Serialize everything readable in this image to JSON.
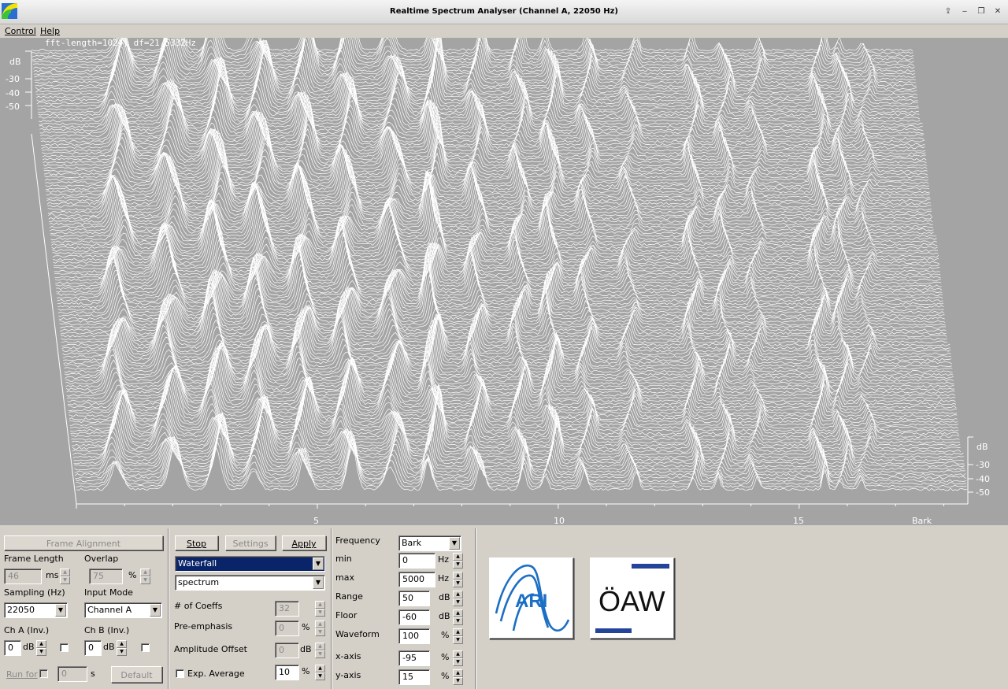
{
  "window": {
    "title": "Realtime Spectrum Analyser (Channel A, 22050 Hz)",
    "controls": {
      "pin": "⇪",
      "minimize": "‒",
      "restore": "❐",
      "close": "✕"
    }
  },
  "menu": [
    {
      "label": "Control"
    },
    {
      "label": "Help"
    }
  ],
  "plot": {
    "fft_info": "fft-length=1024, df=21.5332Hz",
    "left_axis": {
      "unit": "dB",
      "ticks": [
        "-30",
        "-40",
        "-50"
      ]
    },
    "right_axis": {
      "unit": "dB",
      "ticks": [
        "-30",
        "-40",
        "-50"
      ]
    },
    "x_axis": {
      "ticks": [
        "5",
        "10",
        "15"
      ],
      "unit": "Bark"
    }
  },
  "panel": {
    "frame_alignment": "Frame Alignment",
    "frame_length": {
      "label": "Frame Length",
      "value": "46",
      "unit": "ms"
    },
    "overlap": {
      "label": "Overlap",
      "value": "75",
      "unit": "%"
    },
    "sampling": {
      "label": "Sampling (Hz)",
      "value": "22050"
    },
    "input_mode": {
      "label": "Input Mode",
      "value": "Channel A"
    },
    "ch_a": {
      "label": "Ch A (Inv.)",
      "value": "0",
      "unit": "dB"
    },
    "ch_b": {
      "label": "Ch B (Inv.)",
      "value": "0",
      "unit": "dB"
    },
    "run_for": {
      "label": "Run for",
      "value": "0",
      "unit": "s"
    },
    "default_button": "Default",
    "stop_button": "Stop",
    "settings_button": "Settings",
    "apply_button": "Apply",
    "display_mode": "Waterfall",
    "display_type": "spectrum",
    "coeffs": {
      "label": "# of Coeffs",
      "value": "32"
    },
    "pre_emphasis": {
      "label": "Pre-emphasis",
      "value": "0",
      "unit": "%"
    },
    "amplitude_offset": {
      "label": "Amplitude Offset",
      "value": "0",
      "unit": "dB"
    },
    "exp_average": {
      "label": "Exp. Average",
      "value": "10",
      "unit": "%"
    },
    "frequency": {
      "label": "Frequency",
      "value": "Bark"
    },
    "min": {
      "label": "min",
      "value": "0",
      "unit": "Hz"
    },
    "max": {
      "label": "max",
      "value": "5000",
      "unit": "Hz"
    },
    "range": {
      "label": "Range",
      "value": "50",
      "unit": "dB"
    },
    "floor": {
      "label": "Floor",
      "value": "-60",
      "unit": "dB"
    },
    "waveform": {
      "label": "Waveform",
      "value": "100",
      "unit": "%"
    },
    "x_axis": {
      "label": "x-axis",
      "value": "-95",
      "unit": "%"
    },
    "y_axis": {
      "label": "y-axis",
      "value": "15",
      "unit": "%"
    },
    "logo_ari": "ARI",
    "logo_oeaw": "ÖAW"
  },
  "colors": {
    "plot_bg": "#a4a4a4",
    "trace": "#ffffff",
    "selection": "#0a246a",
    "ari_blue": "#1b6fc4",
    "oeaw_blue": "#24449a"
  }
}
